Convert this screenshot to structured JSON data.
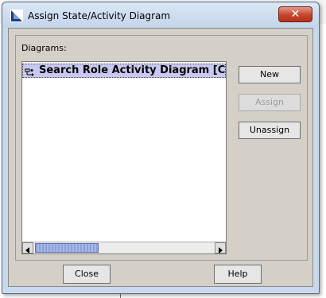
{
  "window": {
    "title": "Assign State/Activity Diagram",
    "close_glyph": "✕"
  },
  "icons": {
    "app": "app-icon",
    "diagram": "activity-diagram-icon",
    "scroll_left": "triangle-left-icon",
    "scroll_right": "triangle-right-icon"
  },
  "diagrams": {
    "label": "Diagrams:",
    "items": [
      {
        "label": "Search Role Activity Diagram [Compo",
        "selected": true
      }
    ],
    "horizontal_scroll_fraction": 0.36
  },
  "buttons": {
    "new": "New",
    "assign": "Assign",
    "unassign": "Unassign",
    "close": "Close",
    "help": "Help"
  },
  "colors": {
    "selection": "#c8c8f0",
    "close_button": "#c6442c",
    "panel": "#d4d0c8"
  }
}
